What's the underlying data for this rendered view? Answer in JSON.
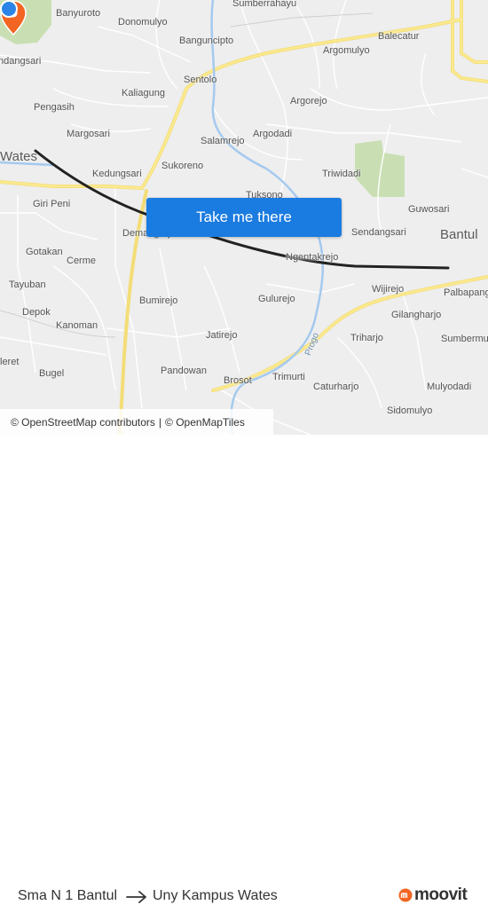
{
  "map": {
    "places": [
      {
        "name": "Banyuroto"
      },
      {
        "name": "Donomulyo"
      },
      {
        "name": "Sumberrahayu"
      },
      {
        "name": "Banguncipto"
      },
      {
        "name": "Balecatur"
      },
      {
        "name": "Argomulyo"
      },
      {
        "name": "ndangsari"
      },
      {
        "name": "Sentolo"
      },
      {
        "name": "Kaliagung"
      },
      {
        "name": "Argorejo"
      },
      {
        "name": "Pengasih"
      },
      {
        "name": "Margosari"
      },
      {
        "name": "Salamrejo"
      },
      {
        "name": "Argodadi"
      },
      {
        "name": "Wates"
      },
      {
        "name": "Sukoreno"
      },
      {
        "name": "Triwidadi"
      },
      {
        "name": "Kedungsari"
      },
      {
        "name": "Giri Peni"
      },
      {
        "name": "Tuksono"
      },
      {
        "name": "Guwosari"
      },
      {
        "name": "Demangrejo"
      },
      {
        "name": "Sendangsari"
      },
      {
        "name": "Bantul"
      },
      {
        "name": "Gotakan"
      },
      {
        "name": "Ngentakrejo"
      },
      {
        "name": "Cerme"
      },
      {
        "name": "Palbapang"
      },
      {
        "name": "Tayuban"
      },
      {
        "name": "Wijirejo"
      },
      {
        "name": "Bumirejo"
      },
      {
        "name": "Gulurejo"
      },
      {
        "name": "Gilangharjo"
      },
      {
        "name": "Depok"
      },
      {
        "name": "Kanoman"
      },
      {
        "name": "Jatirejo"
      },
      {
        "name": "Triharjo"
      },
      {
        "name": "Sumbermu"
      },
      {
        "name": "leret"
      },
      {
        "name": "Pandowan"
      },
      {
        "name": "Bugel"
      },
      {
        "name": "Trimurti"
      },
      {
        "name": "Brosot"
      },
      {
        "name": "Caturharjo"
      },
      {
        "name": "Mulyodadi"
      },
      {
        "name": "Sidomulyo"
      }
    ],
    "river_label": "Progo",
    "cta_label": "Take me there",
    "attribution": {
      "osm": "© OpenStreetMap contributors",
      "separator": "|",
      "tiles": "© OpenMapTiles"
    },
    "colors": {
      "route": "#222222",
      "road": "#fbe98f",
      "water": "#a5c9ef",
      "park": "#c9dfb3",
      "cta": "#1a7be0",
      "pin": "#f26522",
      "origin": "#2b84e8"
    }
  },
  "footer": {
    "from": "Sma N 1 Bantul",
    "to": "Uny Kampus Wates",
    "brand": "moovit"
  }
}
